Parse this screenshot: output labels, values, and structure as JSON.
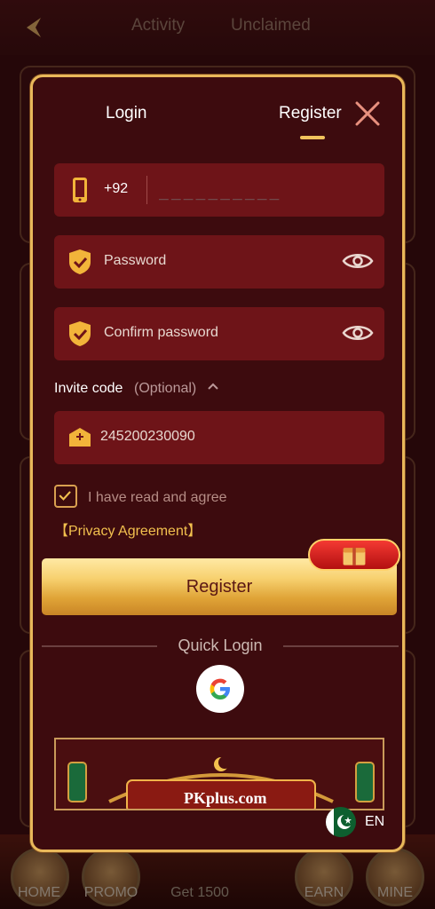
{
  "background": {
    "tabs": [
      "Activity",
      "Unclaimed"
    ],
    "nav": [
      {
        "label": "HOME"
      },
      {
        "label": "PROMO"
      },
      {
        "label": "Get 1500"
      },
      {
        "label": "EARN"
      },
      {
        "label": "MINE"
      }
    ]
  },
  "modal": {
    "tabs": {
      "login": "Login",
      "register": "Register"
    },
    "phone": {
      "country_code": "+92",
      "placeholder": "__________"
    },
    "password": {
      "placeholder": "Password"
    },
    "confirm_password": {
      "placeholder": "Confirm password"
    },
    "invite": {
      "label": "Invite code",
      "optional": "(Optional)",
      "value": "245200230090"
    },
    "agree": {
      "text": "I have read and agree",
      "checked": true
    },
    "privacy_link": "【Privacy Agreement】",
    "register_button": "Register",
    "quick_login": "Quick Login",
    "banner_text": "PKplus.com",
    "language": "EN"
  },
  "colors": {
    "accent": "#f1c35d",
    "field_bg": "#6e1418",
    "modal_bg": "#3d0b0e",
    "border": "#e9b85a"
  },
  "icons": [
    "back-icon",
    "close-icon",
    "phone-icon",
    "shield-check-icon",
    "eye-icon",
    "chevron-up-icon",
    "envelope-icon",
    "check-icon",
    "gift-icon",
    "google-icon",
    "pakistan-flag-icon"
  ]
}
